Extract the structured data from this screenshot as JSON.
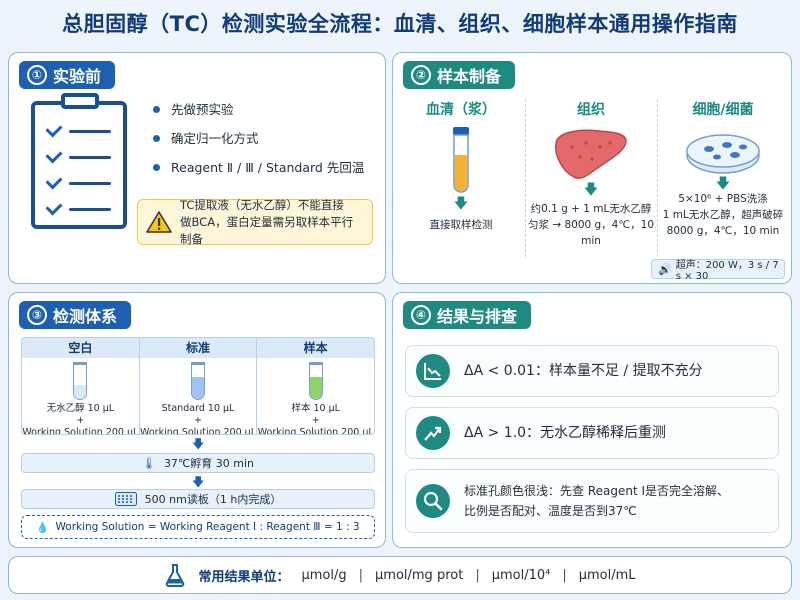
{
  "title": "总胆固醇（TC）检测实验全流程：血清、组织、细胞样本通用操作指南",
  "p1": {
    "num": "①",
    "title": "实验前",
    "bullets": [
      "先做预实验",
      "确定归一化方式",
      "Reagent Ⅱ / Ⅲ / Standard 先回温"
    ],
    "warn_l1": "TC提取液（无水乙醇）不能直接",
    "warn_l2": "做BCA，蛋白定量需另取样本平行制备"
  },
  "p2": {
    "num": "②",
    "title": "样本制备",
    "serum": {
      "title": "血清（浆）",
      "desc": "直接取样检测"
    },
    "tissue": {
      "title": "组织",
      "l1": "约0.1 g + 1 mL无水乙醇",
      "l2": "匀浆 → 8000 g，4℃，10 min"
    },
    "cell": {
      "title": "细胞/细菌",
      "l1": "5×10⁶ + PBS洗涤",
      "l2": "1 mL无水乙醇，超声破碎",
      "l3": "8000 g，4℃，10 min"
    },
    "sonic": "超声：200 W，3 s / 7 s × 30"
  },
  "p3": {
    "num": "③",
    "title": "检测体系",
    "cols": [
      {
        "head": "空白",
        "l1": "无水乙醇 10 μL",
        "plus": "+",
        "l2": "Working Solution 200 μL"
      },
      {
        "head": "标准",
        "l1": "Standard 10 μL",
        "plus": "+",
        "l2": "Working Solution 200 μL"
      },
      {
        "head": "样本",
        "l1": "样本 10 μL",
        "plus": "+",
        "l2": "Working Solution 200 μL"
      }
    ],
    "incubate": "37℃孵育  30 min",
    "read": "500 nm读板（1 h内完成）",
    "formula": "Working Solution = Working Reagent Ⅰ : Reagent Ⅲ = 1 : 3"
  },
  "p4": {
    "num": "④",
    "title": "结果与排查",
    "r1": "ΔA < 0.01：样本量不足 / 提取不充分",
    "r2": "ΔA > 1.0：无水乙醇稀释后重测",
    "r3_l1": "标准孔颜色很浅：先查 Reagent Ⅰ是否完全溶解、",
    "r3_l2": "比例是否配对、温度是否到37℃"
  },
  "footer": {
    "label": "常用结果单位：",
    "u1": "μmol/g",
    "sep": "|",
    "u2": "μmol/mg prot",
    "u3": "μmol/10⁴",
    "u4": "μmol/mL"
  },
  "colors": {
    "primary": "#1c5fb3",
    "teal": "#1e8a82",
    "warn": "#f0c94a"
  }
}
